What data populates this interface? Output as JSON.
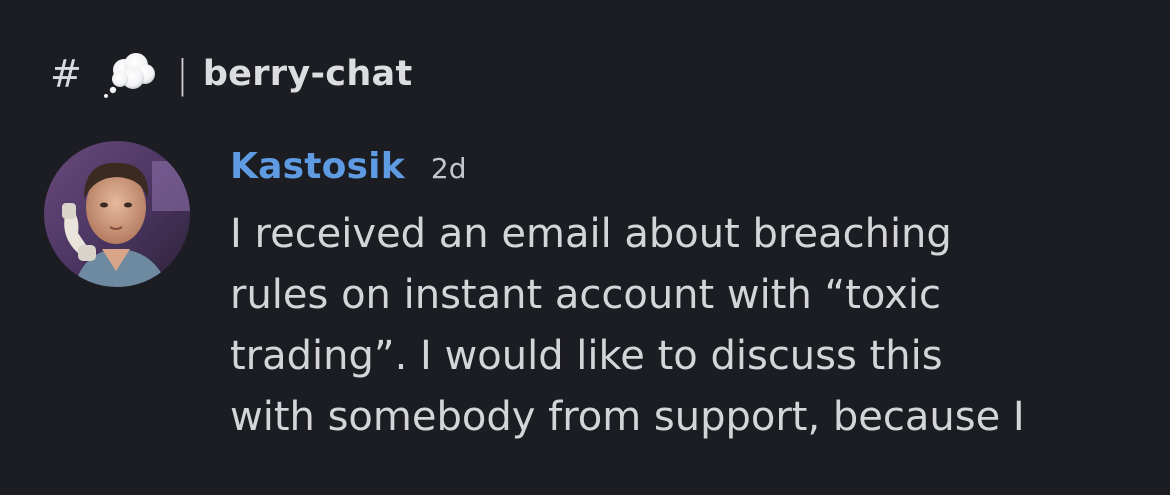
{
  "channel": {
    "hash": "#",
    "separator": "|",
    "name": "berry-chat",
    "emoji": "thought-balloon-icon"
  },
  "message": {
    "author": "Kastosik",
    "timestamp": "2d",
    "lines": [
      "I received an email about breaching",
      "rules on instant account with “toxic",
      "trading”. I would like to discuss this",
      "with somebody from support, because I"
    ],
    "author_color": "#5e9be2"
  },
  "theme": {
    "background": "#1c1d22",
    "text": "#d3d5d9"
  }
}
